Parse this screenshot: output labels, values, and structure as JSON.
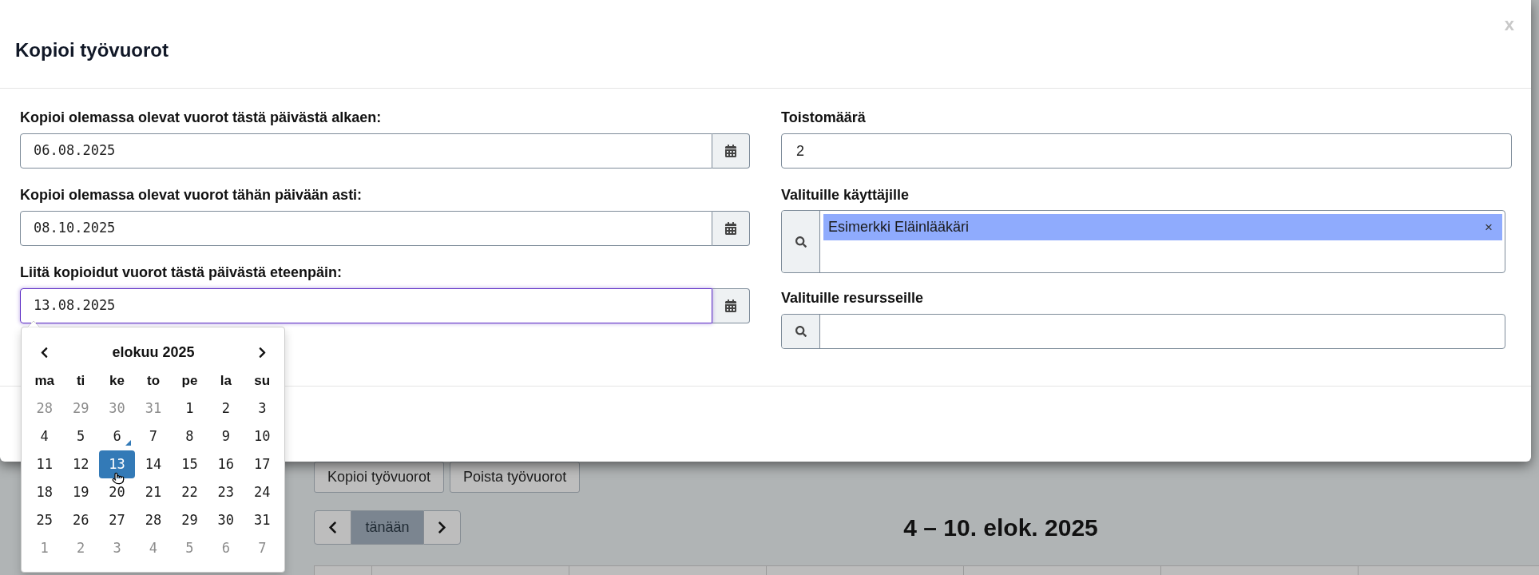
{
  "modal": {
    "title": "Kopioi työvuorot",
    "close": "x",
    "date_fields": [
      {
        "label": "Kopioi olemassa olevat vuorot tästä päivästä alkaen:",
        "value": "06.08.2025",
        "focused": false
      },
      {
        "label": "Kopioi olemassa olevat vuorot tähän päivään asti:",
        "value": "08.10.2025",
        "focused": false
      },
      {
        "label": "Liitä kopioidut vuorot tästä päivästä eteenpäin:",
        "value": "13.08.2025",
        "focused": true
      }
    ],
    "repeat_field": {
      "label": "Toistomäärä",
      "value": "2"
    },
    "user_field": {
      "label": "Valituille käyttäjille",
      "tags": [
        {
          "label": "Esimerkki Eläinlääkäri",
          "remove": "×"
        }
      ]
    },
    "resource_field": {
      "label": "Valituille resursseille"
    }
  },
  "datepicker": {
    "title": "elokuu 2025",
    "weekdays": [
      "ma",
      "ti",
      "ke",
      "to",
      "pe",
      "la",
      "su"
    ],
    "weeks": [
      [
        {
          "day": "28",
          "muted": true,
          "today": false,
          "selected": false
        },
        {
          "day": "29",
          "muted": true,
          "today": false,
          "selected": false
        },
        {
          "day": "30",
          "muted": true,
          "today": false,
          "selected": false
        },
        {
          "day": "31",
          "muted": true,
          "today": false,
          "selected": false
        },
        {
          "day": "1",
          "muted": false,
          "today": false,
          "selected": false
        },
        {
          "day": "2",
          "muted": false,
          "today": false,
          "selected": false
        },
        {
          "day": "3",
          "muted": false,
          "today": false,
          "selected": false
        }
      ],
      [
        {
          "day": "4",
          "muted": false,
          "today": false,
          "selected": false
        },
        {
          "day": "5",
          "muted": false,
          "today": false,
          "selected": false
        },
        {
          "day": "6",
          "muted": false,
          "today": true,
          "selected": false
        },
        {
          "day": "7",
          "muted": false,
          "today": false,
          "selected": false
        },
        {
          "day": "8",
          "muted": false,
          "today": false,
          "selected": false
        },
        {
          "day": "9",
          "muted": false,
          "today": false,
          "selected": false
        },
        {
          "day": "10",
          "muted": false,
          "today": false,
          "selected": false
        }
      ],
      [
        {
          "day": "11",
          "muted": false,
          "today": false,
          "selected": false
        },
        {
          "day": "12",
          "muted": false,
          "today": false,
          "selected": false
        },
        {
          "day": "13",
          "muted": false,
          "today": false,
          "selected": true
        },
        {
          "day": "14",
          "muted": false,
          "today": false,
          "selected": false
        },
        {
          "day": "15",
          "muted": false,
          "today": false,
          "selected": false
        },
        {
          "day": "16",
          "muted": false,
          "today": false,
          "selected": false
        },
        {
          "day": "17",
          "muted": false,
          "today": false,
          "selected": false
        }
      ],
      [
        {
          "day": "18",
          "muted": false,
          "today": false,
          "selected": false
        },
        {
          "day": "19",
          "muted": false,
          "today": false,
          "selected": false
        },
        {
          "day": "20",
          "muted": false,
          "today": false,
          "selected": false
        },
        {
          "day": "21",
          "muted": false,
          "today": false,
          "selected": false
        },
        {
          "day": "22",
          "muted": false,
          "today": false,
          "selected": false
        },
        {
          "day": "23",
          "muted": false,
          "today": false,
          "selected": false
        },
        {
          "day": "24",
          "muted": false,
          "today": false,
          "selected": false
        }
      ],
      [
        {
          "day": "25",
          "muted": false,
          "today": false,
          "selected": false
        },
        {
          "day": "26",
          "muted": false,
          "today": false,
          "selected": false
        },
        {
          "day": "27",
          "muted": false,
          "today": false,
          "selected": false
        },
        {
          "day": "28",
          "muted": false,
          "today": false,
          "selected": false
        },
        {
          "day": "29",
          "muted": false,
          "today": false,
          "selected": false
        },
        {
          "day": "30",
          "muted": false,
          "today": false,
          "selected": false
        },
        {
          "day": "31",
          "muted": false,
          "today": false,
          "selected": false
        }
      ],
      [
        {
          "day": "1",
          "muted": true,
          "today": false,
          "selected": false
        },
        {
          "day": "2",
          "muted": true,
          "today": false,
          "selected": false
        },
        {
          "day": "3",
          "muted": true,
          "today": false,
          "selected": false
        },
        {
          "day": "4",
          "muted": true,
          "today": false,
          "selected": false
        },
        {
          "day": "5",
          "muted": true,
          "today": false,
          "selected": false
        },
        {
          "day": "6",
          "muted": true,
          "today": false,
          "selected": false
        },
        {
          "day": "7",
          "muted": true,
          "today": false,
          "selected": false
        }
      ]
    ]
  },
  "background_page": {
    "buttons": [
      {
        "label": "Kopioi työvuorot"
      },
      {
        "label": "Poista työvuorot"
      }
    ],
    "today_button": {
      "label": "tänään",
      "disabled": true
    },
    "range_title": "4 – 10. elok. 2025"
  }
}
